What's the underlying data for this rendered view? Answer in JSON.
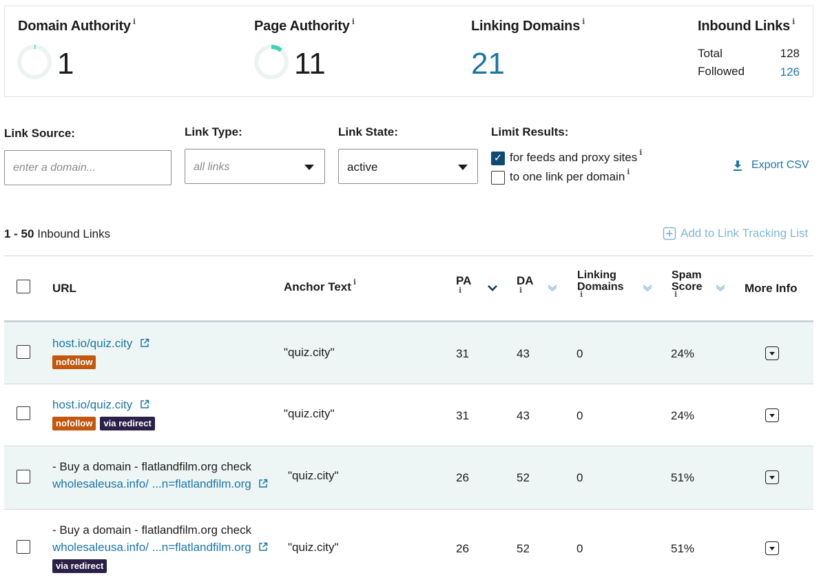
{
  "metrics": {
    "domain_authority": {
      "label": "Domain Authority",
      "info": "i",
      "value": "1",
      "ring_fraction": 0.01
    },
    "page_authority": {
      "label": "Page Authority",
      "info": "i",
      "value": "11",
      "ring_fraction": 0.11
    },
    "linking_domains": {
      "label": "Linking Domains",
      "info": "i",
      "value": "21"
    },
    "inbound_links": {
      "label": "Inbound Links",
      "info": "i",
      "total_label": "Total",
      "total_value": "128",
      "followed_label": "Followed",
      "followed_value": "126"
    }
  },
  "filters": {
    "link_source": {
      "label": "Link Source:",
      "placeholder": "enter a domain..."
    },
    "link_type": {
      "label": "Link Type:",
      "value": "all links"
    },
    "link_state": {
      "label": "Link State:",
      "value": "active"
    },
    "limit_results": {
      "label": "Limit Results:",
      "opt1": {
        "label": "for feeds and proxy sites",
        "checked": true
      },
      "opt2": {
        "label": "to one link per domain",
        "checked": false
      }
    },
    "export_label": "Export CSV"
  },
  "results": {
    "range": "1 - 50",
    "range_suffix": "Inbound Links",
    "add_tracking": "Add to Link Tracking List"
  },
  "table": {
    "headers": {
      "url": "URL",
      "anchor": "Anchor Text",
      "pa": "PA",
      "da": "DA",
      "linking_1": "Linking",
      "linking_2": "Domains",
      "spam_1": "Spam",
      "spam_2": "Score",
      "more": "More Info",
      "info": "i"
    },
    "rows": [
      {
        "title": "",
        "url": "host.io/quiz.city",
        "badges": [
          "nofollow"
        ],
        "anchor": "\"quiz.city\"",
        "pa": "31",
        "da": "43",
        "linking": "0",
        "spam": "24%"
      },
      {
        "title": "",
        "url": "host.io/quiz.city",
        "badges": [
          "nofollow",
          "via redirect"
        ],
        "anchor": "\"quiz.city\"",
        "pa": "31",
        "da": "43",
        "linking": "0",
        "spam": "24%"
      },
      {
        "title": "- Buy a domain - flatlandfilm.org check",
        "url": "wholesaleusa.info/ ...n=flatlandfilm.org",
        "badges": [],
        "anchor": "\"quiz.city\"",
        "pa": "26",
        "da": "52",
        "linking": "0",
        "spam": "51%"
      },
      {
        "title": "- Buy a domain - flatlandfilm.org check",
        "url": "wholesaleusa.info/ ...n=flatlandfilm.org",
        "badges": [
          "via redirect"
        ],
        "anchor": "\"quiz.city\"",
        "pa": "26",
        "da": "52",
        "linking": "0",
        "spam": "51%"
      }
    ]
  },
  "colors": {
    "accent_blue": "#1b75a8",
    "row_tint": "#edf6f4",
    "nofollow": "#c2570d",
    "redirect": "#2b2148",
    "ring_teal": "#3fd1b5"
  },
  "icons": [
    "info-icon",
    "progress-ring-icon",
    "dropdown-caret-icon",
    "checkbox-icon",
    "download-icon",
    "plus-square-icon",
    "sort-chevron-icon",
    "external-link-icon",
    "expand-icon"
  ]
}
